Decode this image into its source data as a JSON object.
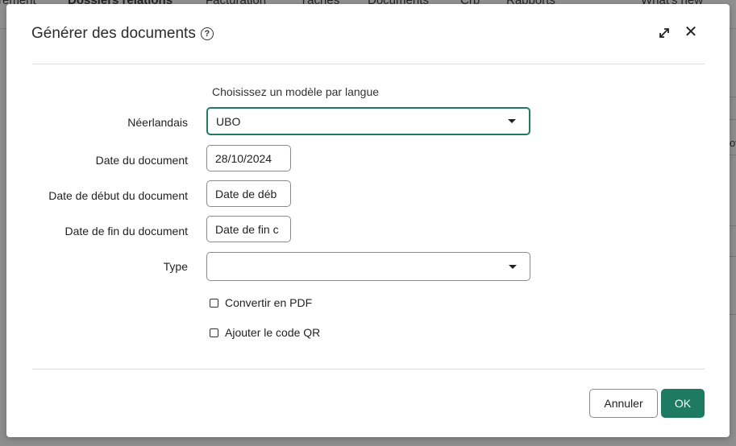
{
  "background": {
    "nav_items": [
      "rement",
      "Dossiers relations",
      "Facturation",
      "Tâches",
      "Documents",
      "Crb",
      "Rapports",
      "What's new"
    ],
    "side_text": "ov"
  },
  "dialog": {
    "title": "Générer des documents",
    "subtitle": "Choisissez un modèle par langue",
    "fields": {
      "dutch": {
        "label": "Néerlandais",
        "value": "UBO"
      },
      "document_date": {
        "label": "Date du document",
        "value": "28/10/2024"
      },
      "start_date": {
        "label": "Date de début du document",
        "placeholder": "Date de déb"
      },
      "end_date": {
        "label": "Date de fin du document",
        "placeholder": "Date de fin c"
      },
      "type": {
        "label": "Type",
        "value": ""
      }
    },
    "checkboxes": {
      "pdf": {
        "label": "Convertir en PDF",
        "checked": false
      },
      "qr": {
        "label": "Ajouter le code QR",
        "checked": false
      }
    },
    "buttons": {
      "cancel": "Annuler",
      "ok": "OK"
    },
    "colors": {
      "accent": "#1e7a61"
    }
  }
}
